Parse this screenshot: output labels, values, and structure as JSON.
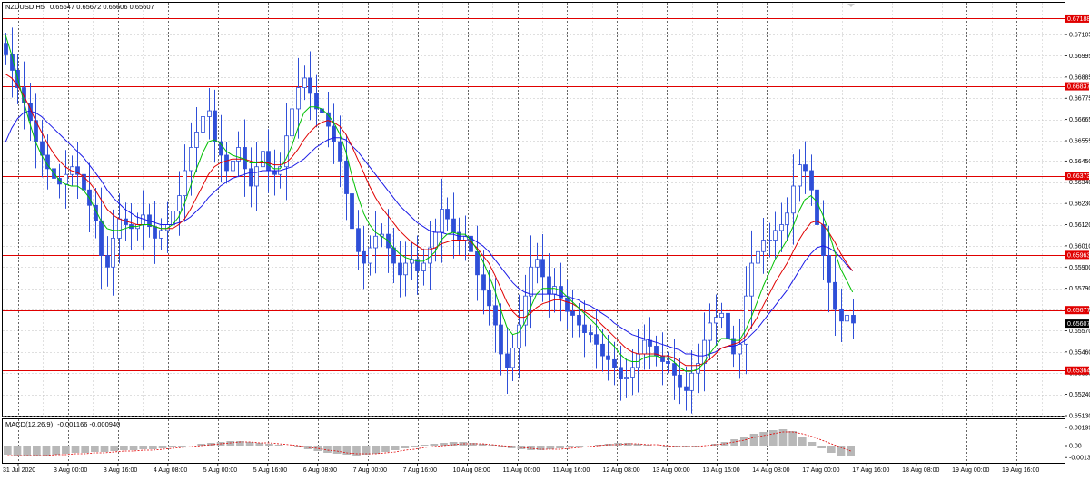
{
  "chart_header": {
    "symbol": "NZDUSD,H5",
    "ohlc": "0.65647 0.65672 0.65606 0.65607"
  },
  "macd_header": {
    "label": "MACD(12,26,9)",
    "values": "-0.001166 -0.000940"
  },
  "colors": {
    "candle": "#2f4fd8",
    "ma_fast": "#00c000",
    "ma_mid": "#e00000",
    "ma_slow": "#1a1ae6",
    "hline": "#e00000",
    "price_tag_bg": "#e00000",
    "current_tag_bg": "#000000",
    "grid": "#c0c0c0",
    "macd_hist": "#b8b8b8",
    "macd_signal": "#e00000"
  },
  "chart_data": {
    "type": "candlestick",
    "series": [
      {
        "name": "NZDUSD,H5",
        "ylim": [
          0.6513,
          0.6727
        ]
      }
    ],
    "y_ticks": [
      "0.67105",
      "0.66995",
      "0.66885",
      "0.66775",
      "0.66665",
      "0.66555",
      "0.66450",
      "0.66340",
      "0.66230",
      "0.66120",
      "0.66010",
      "0.65900",
      "0.65790",
      "0.65680",
      "0.65570",
      "0.65460",
      "0.65350",
      "0.65240",
      "0.65130"
    ],
    "horizontal_levels": [
      "0.67188",
      "0.66837",
      "0.66373",
      "0.65963",
      "0.65677",
      "0.65364"
    ],
    "current_price": "0.65607",
    "x_ticks": [
      "31 Jul 2020",
      "3 Aug 00:00",
      "3 Aug 16:00",
      "4 Aug 08:00",
      "5 Aug 00:00",
      "5 Aug 16:00",
      "6 Aug 08:00",
      "7 Aug 00:00",
      "7 Aug 16:00",
      "10 Aug 08:00",
      "11 Aug 00:00",
      "11 Aug 16:00",
      "12 Aug 08:00",
      "13 Aug 00:00",
      "13 Aug 16:00",
      "14 Aug 08:00",
      "17 Aug 00:00",
      "17 Aug 16:00",
      "18 Aug 08:00",
      "19 Aug 00:00",
      "19 Aug 16:00"
    ],
    "closes": [
      0.67,
      0.6692,
      0.6683,
      0.6675,
      0.6666,
      0.6655,
      0.6648,
      0.6641,
      0.6636,
      0.6633,
      0.6638,
      0.6642,
      0.6638,
      0.663,
      0.6622,
      0.6614,
      0.6596,
      0.659,
      0.6605,
      0.6615,
      0.6612,
      0.661,
      0.6612,
      0.6617,
      0.6611,
      0.6605,
      0.6609,
      0.6612,
      0.6619,
      0.6627,
      0.664,
      0.6652,
      0.666,
      0.6668,
      0.6671,
      0.6655,
      0.6648,
      0.664,
      0.6645,
      0.6652,
      0.6641,
      0.6632,
      0.6642,
      0.665,
      0.664,
      0.6638,
      0.6642,
      0.6658,
      0.6672,
      0.6683,
      0.6688,
      0.668,
      0.6672,
      0.667,
      0.6663,
      0.6655,
      0.6645,
      0.6628,
      0.661,
      0.6598,
      0.6592,
      0.66,
      0.6606,
      0.6607,
      0.66,
      0.6592,
      0.6586,
      0.6592,
      0.6594,
      0.6588,
      0.6592,
      0.66,
      0.6608,
      0.662,
      0.6615,
      0.6608,
      0.6604,
      0.6606,
      0.6598,
      0.6586,
      0.6578,
      0.657,
      0.656,
      0.6545,
      0.6538,
      0.6548,
      0.656,
      0.6575,
      0.659,
      0.6594,
      0.6585,
      0.6576,
      0.658,
      0.6574,
      0.6567,
      0.6565,
      0.656,
      0.6556,
      0.6555,
      0.655,
      0.6544,
      0.6542,
      0.6538,
      0.6532,
      0.6533,
      0.6538,
      0.6545,
      0.6552,
      0.6549,
      0.6544,
      0.6541,
      0.654,
      0.6534,
      0.6528,
      0.6526,
      0.6535,
      0.654,
      0.6552,
      0.6561,
      0.6564,
      0.6566,
      0.6553,
      0.6545,
      0.655,
      0.6575,
      0.6592,
      0.6598,
      0.6604,
      0.6604,
      0.6609,
      0.6612,
      0.6618,
      0.6632,
      0.6643,
      0.664,
      0.663,
      0.6612,
      0.6596,
      0.6582,
      0.6568,
      0.6562,
      0.6565,
      0.6561
    ],
    "ma_fast": [
      0.671,
      0.67,
      0.6688,
      0.6676,
      0.6665,
      0.6655,
      0.6648,
      0.6643,
      0.6639,
      0.6635,
      0.6633,
      0.6632,
      0.6632,
      0.663,
      0.6626,
      0.662,
      0.6614,
      0.661,
      0.6609,
      0.6609,
      0.661,
      0.6611,
      0.6611,
      0.6612,
      0.6612,
      0.6611,
      0.661,
      0.661,
      0.6612,
      0.6616,
      0.6623,
      0.6632,
      0.6641,
      0.6649,
      0.6655,
      0.6656,
      0.6654,
      0.665,
      0.6648,
      0.6647,
      0.6646,
      0.6644,
      0.6644,
      0.6645,
      0.6643,
      0.6641,
      0.6641,
      0.6646,
      0.6653,
      0.6662,
      0.667,
      0.6673,
      0.6673,
      0.6672,
      0.6669,
      0.6665,
      0.6659,
      0.665,
      0.6638,
      0.6627,
      0.6618,
      0.6612,
      0.6608,
      0.6606,
      0.6604,
      0.66,
      0.6597,
      0.6595,
      0.6594,
      0.6593,
      0.6593,
      0.6595,
      0.6598,
      0.6604,
      0.6607,
      0.6608,
      0.6607,
      0.6607,
      0.6604,
      0.6599,
      0.6593,
      0.6586,
      0.6578,
      0.6568,
      0.6559,
      0.6555,
      0.6556,
      0.6561,
      0.6569,
      0.6576,
      0.6579,
      0.6579,
      0.6579,
      0.6578,
      0.6575,
      0.6572,
      0.6569,
      0.6566,
      0.6563,
      0.656,
      0.6556,
      0.6552,
      0.6549,
      0.6545,
      0.6542,
      0.6541,
      0.6541,
      0.6543,
      0.6544,
      0.6544,
      0.6543,
      0.6543,
      0.6541,
      0.6538,
      0.6536,
      0.6536,
      0.6537,
      0.654,
      0.6545,
      0.6549,
      0.6553,
      0.6553,
      0.6552,
      0.6552,
      0.6557,
      0.6564,
      0.6572,
      0.658,
      0.6587,
      0.6594,
      0.6599,
      0.6604,
      0.6611,
      0.6619,
      0.6625,
      0.6627,
      0.6624,
      0.6617,
      0.6608,
      0.6598,
      0.6589,
      0.6583,
      0.6577
    ],
    "ma_mid": [
      0.669,
      0.6688,
      0.6684,
      0.6679,
      0.6673,
      0.6666,
      0.666,
      0.6654,
      0.6649,
      0.6645,
      0.6642,
      0.664,
      0.6639,
      0.6637,
      0.6634,
      0.663,
      0.6625,
      0.662,
      0.6617,
      0.6615,
      0.6614,
      0.6613,
      0.6612,
      0.6612,
      0.6612,
      0.6611,
      0.661,
      0.661,
      0.661,
      0.6612,
      0.6615,
      0.662,
      0.6626,
      0.6632,
      0.6638,
      0.6642,
      0.6644,
      0.6645,
      0.6646,
      0.6646,
      0.6646,
      0.6645,
      0.6644,
      0.6644,
      0.6644,
      0.6643,
      0.6643,
      0.6644,
      0.6647,
      0.6651,
      0.6656,
      0.666,
      0.6663,
      0.6665,
      0.6666,
      0.6665,
      0.6663,
      0.6659,
      0.6653,
      0.6646,
      0.6639,
      0.6632,
      0.6626,
      0.6621,
      0.6617,
      0.6613,
      0.6609,
      0.6606,
      0.6603,
      0.6601,
      0.6599,
      0.6599,
      0.66,
      0.6602,
      0.6603,
      0.6604,
      0.6604,
      0.6604,
      0.6603,
      0.66,
      0.6596,
      0.6592,
      0.6586,
      0.6579,
      0.6572,
      0.6567,
      0.6564,
      0.6564,
      0.6566,
      0.6569,
      0.6571,
      0.6572,
      0.6573,
      0.6573,
      0.6572,
      0.6571,
      0.6569,
      0.6567,
      0.6565,
      0.6563,
      0.656,
      0.6557,
      0.6554,
      0.6551,
      0.6548,
      0.6546,
      0.6545,
      0.6545,
      0.6545,
      0.6545,
      0.6544,
      0.6544,
      0.6543,
      0.6541,
      0.6539,
      0.6539,
      0.6539,
      0.654,
      0.6542,
      0.6545,
      0.6548,
      0.6549,
      0.655,
      0.6551,
      0.6554,
      0.6559,
      0.6564,
      0.657,
      0.6576,
      0.6582,
      0.6587,
      0.6592,
      0.6598,
      0.6604,
      0.6609,
      0.6613,
      0.6614,
      0.6612,
      0.6608,
      0.6603,
      0.6597,
      0.6592,
      0.6588
    ],
    "ma_slow": [
      0.6655,
      0.6662,
      0.6667,
      0.667,
      0.6671,
      0.667,
      0.6668,
      0.6665,
      0.6662,
      0.6659,
      0.6656,
      0.6653,
      0.665,
      0.6647,
      0.6643,
      0.6639,
      0.6635,
      0.663,
      0.6626,
      0.6623,
      0.662,
      0.6618,
      0.6616,
      0.6615,
      0.6614,
      0.6613,
      0.6612,
      0.6612,
      0.6612,
      0.6613,
      0.6614,
      0.6616,
      0.6619,
      0.6622,
      0.6626,
      0.6629,
      0.6632,
      0.6634,
      0.6636,
      0.6637,
      0.6638,
      0.6639,
      0.6639,
      0.664,
      0.664,
      0.664,
      0.664,
      0.6641,
      0.6642,
      0.6644,
      0.6646,
      0.6649,
      0.6652,
      0.6654,
      0.6656,
      0.6657,
      0.6657,
      0.6656,
      0.6653,
      0.665,
      0.6646,
      0.6642,
      0.6638,
      0.6634,
      0.663,
      0.6626,
      0.6622,
      0.6619,
      0.6616,
      0.6613,
      0.6611,
      0.6609,
      0.6608,
      0.6608,
      0.6607,
      0.6607,
      0.6606,
      0.6606,
      0.6605,
      0.6603,
      0.6601,
      0.6598,
      0.6594,
      0.659,
      0.6586,
      0.6582,
      0.6579,
      0.6577,
      0.6576,
      0.6576,
      0.6576,
      0.6576,
      0.6576,
      0.6575,
      0.6575,
      0.6574,
      0.6573,
      0.6571,
      0.657,
      0.6568,
      0.6566,
      0.6564,
      0.6561,
      0.6559,
      0.6557,
      0.6555,
      0.6554,
      0.6553,
      0.6552,
      0.6551,
      0.655,
      0.6549,
      0.6548,
      0.6547,
      0.6545,
      0.6545,
      0.6544,
      0.6544,
      0.6545,
      0.6546,
      0.6548,
      0.6549,
      0.6549,
      0.655,
      0.6552,
      0.6555,
      0.6558,
      0.6562,
      0.6566,
      0.657,
      0.6574,
      0.6578,
      0.6583,
      0.6588,
      0.6593,
      0.6597,
      0.66,
      0.6601,
      0.66,
      0.6598,
      0.6595,
      0.6591,
      0.6588
    ],
    "macd": {
      "ylim": [
        -0.0015,
        0.0025
      ],
      "y_ticks": [
        "0.001997",
        "0.00",
        "-0.001319"
      ],
      "histogram": [
        -0.001,
        -0.0011,
        -0.0012,
        -0.0012,
        -0.0011,
        -0.001,
        -0.0009,
        -0.0008,
        -0.0008,
        -0.0007,
        -0.0007,
        -0.0006,
        -0.0005,
        -0.0005,
        -0.0004,
        -0.0004,
        -0.0003,
        -0.0002,
        -0.0001,
        0.0,
        0.0002,
        0.0003,
        0.0004,
        0.0005,
        0.0005,
        0.0004,
        0.0003,
        0.0002,
        0.0001,
        0.0,
        -0.0002,
        -0.0004,
        -0.0006,
        -0.0008,
        -0.0009,
        -0.001,
        -0.0011,
        -0.001,
        -0.0009,
        -0.0007,
        -0.0005,
        -0.0003,
        -0.0001,
        0.0001,
        0.0002,
        0.0003,
        0.0004,
        0.0004,
        0.0003,
        0.0002,
        0.0001,
        -0.0001,
        -0.0003,
        -0.0004,
        -0.0005,
        -0.0005,
        -0.0004,
        -0.0003,
        -0.0002,
        -0.0001,
        0.0,
        0.0001,
        0.0002,
        0.0003,
        0.0003,
        0.0002,
        0.0001,
        0.0,
        -0.0001,
        -0.0002,
        -0.0002,
        -0.0001,
        0.0,
        0.0002,
        0.0004,
        0.0007,
        0.001,
        0.0013,
        0.0015,
        0.0017,
        0.0018,
        0.0016,
        0.001,
        0.0004,
        -0.0003,
        -0.0008,
        -0.0011,
        -0.0012
      ],
      "signal": [
        -0.0011,
        -0.0011,
        -0.0011,
        -0.0011,
        -0.0011,
        -0.001,
        -0.001,
        -0.0009,
        -0.0009,
        -0.0008,
        -0.0008,
        -0.0007,
        -0.0006,
        -0.0006,
        -0.0005,
        -0.0005,
        -0.0004,
        -0.0003,
        -0.0002,
        -0.0001,
        0.0,
        0.0001,
        0.0002,
        0.0003,
        0.0004,
        0.0004,
        0.0003,
        0.0003,
        0.0002,
        0.0001,
        0.0,
        -0.0002,
        -0.0003,
        -0.0005,
        -0.0006,
        -0.0008,
        -0.0009,
        -0.0009,
        -0.0009,
        -0.0008,
        -0.0007,
        -0.0005,
        -0.0004,
        -0.0002,
        -0.0001,
        0.0,
        0.0001,
        0.0002,
        0.0002,
        0.0002,
        0.0001,
        0.0,
        -0.0001,
        -0.0002,
        -0.0003,
        -0.0004,
        -0.0004,
        -0.0004,
        -0.0003,
        -0.0002,
        -0.0001,
        0.0,
        0.0001,
        0.0001,
        0.0002,
        0.0002,
        0.0001,
        0.0001,
        0.0,
        -0.0001,
        -0.0001,
        -0.0001,
        0.0,
        0.0001,
        0.0002,
        0.0004,
        0.0006,
        0.0009,
        0.0011,
        0.0013,
        0.0015,
        0.0015,
        0.0013,
        0.001,
        0.0006,
        0.0002,
        -0.0002,
        -0.0006
      ]
    }
  }
}
